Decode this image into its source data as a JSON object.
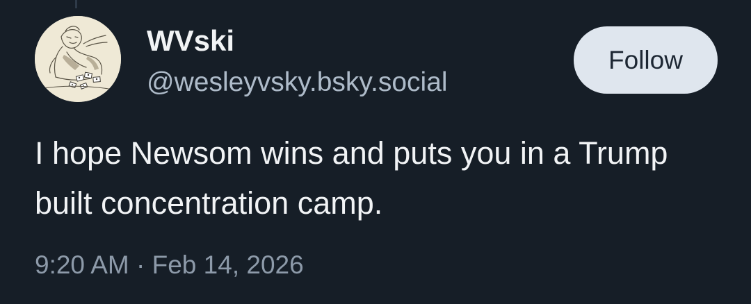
{
  "post": {
    "author": {
      "display_name": "WVski",
      "handle": "@wesleyvsky.bsky.social"
    },
    "follow_label": "Follow",
    "text": "I hope Newsom wins and puts you in a Trump built concentration camp.",
    "timestamp": "9:20 AM · Feb 14, 2026"
  },
  "colors": {
    "background": "#161e27",
    "text_primary": "#f1f3f5",
    "text_secondary": "#aebbc9",
    "button_bg": "#dfe6ee",
    "button_text": "#1d2733"
  },
  "icons": {
    "avatar": "sketch-drawing-avatar"
  }
}
